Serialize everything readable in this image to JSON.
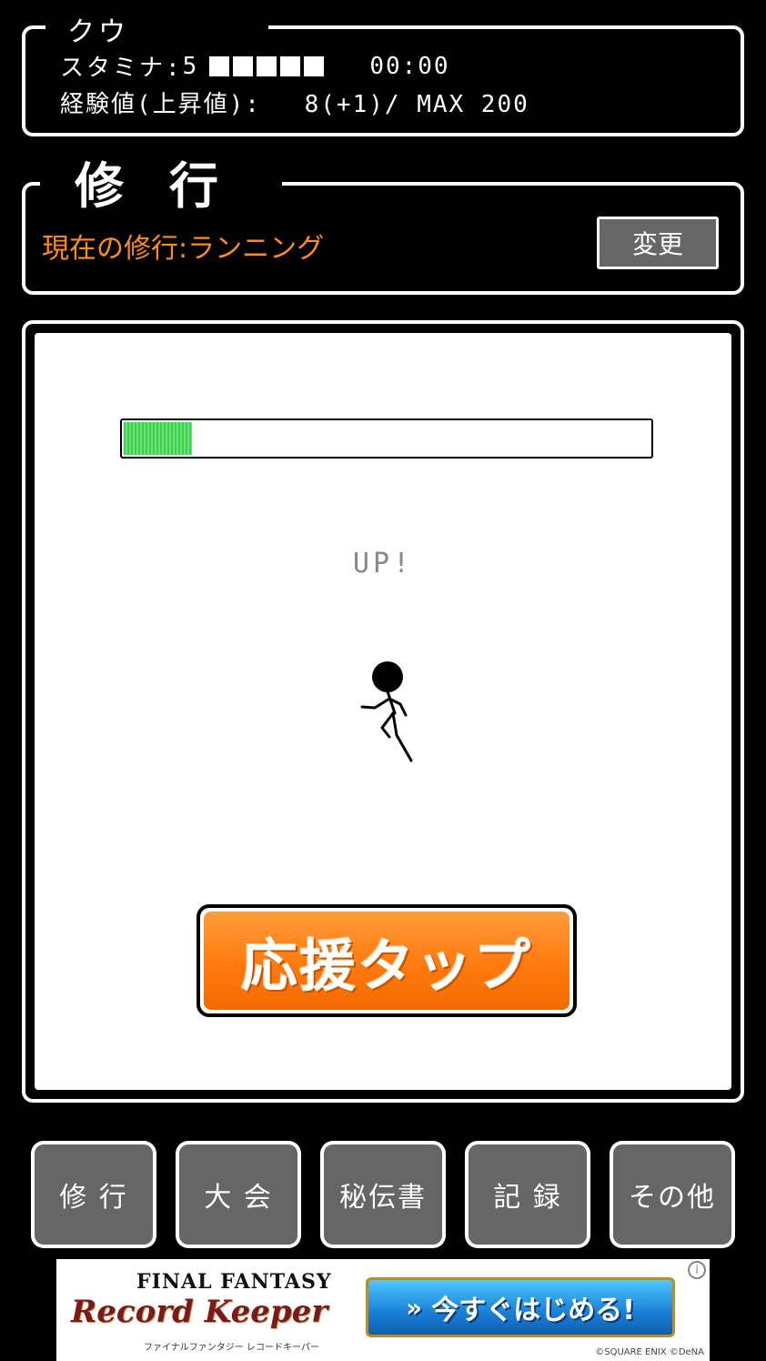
{
  "status": {
    "character_name": "クウ",
    "stamina_label": "スタミナ:",
    "stamina_value": "5",
    "stamina_max_pips": 5,
    "stamina_filled_pips": 5,
    "stamina_timer": "00:00",
    "exp_label": "経験値(上昇値):",
    "exp_value": "8(+1)/ MAX 200"
  },
  "training": {
    "title": "修行",
    "current_label": "現在の修行:ランニング",
    "change_button_label": "変更"
  },
  "main": {
    "progress_fraction": 0.13,
    "progress_color": "#3ad14f",
    "status_text": "UP!",
    "cheer_button_label": "応援タップ",
    "cheer_button_color": "#ff7a0e"
  },
  "nav": {
    "items": [
      {
        "label": "修 行"
      },
      {
        "label": "大 会"
      },
      {
        "label": "秘伝書"
      },
      {
        "label": "記 録"
      },
      {
        "label": "その他"
      }
    ]
  },
  "ad": {
    "title_top": "FINAL FANTASY",
    "title_main": "Record Keeper",
    "subtitle": "ファイナルファンタジー レコードキーパー",
    "cta_label": "今すぐはじめる!",
    "cta_icon": "double-chevron-right-icon",
    "copyright": "©SQUARE ENIX ©DeNA",
    "info_icon": "info-icon"
  }
}
